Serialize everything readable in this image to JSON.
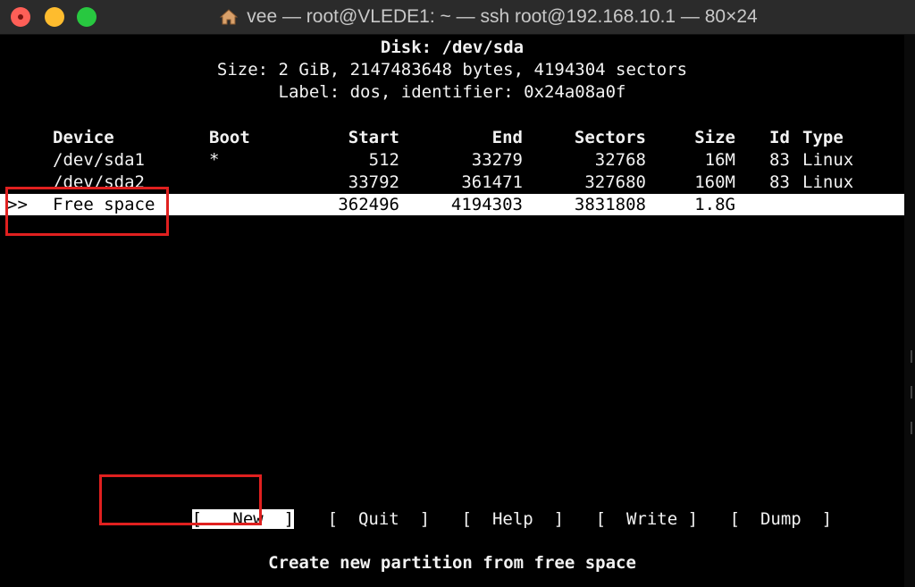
{
  "window": {
    "title": "vee — root@VLEDE1: ~ — ssh root@192.168.10.1 — 80×24",
    "icon": "home-icon"
  },
  "header": {
    "disk": "Disk: /dev/sda",
    "size": "Size: 2 GiB, 2147483648 bytes, 4194304 sectors",
    "label": "Label: dos, identifier: 0x24a08a0f"
  },
  "table": {
    "columns": [
      "Device",
      "Boot",
      "Start",
      "End",
      "Sectors",
      "Size",
      "Id",
      "Type"
    ],
    "rows": [
      {
        "marker": "",
        "device": "/dev/sda1",
        "boot": "*",
        "start": "512",
        "end": "33279",
        "sectors": "32768",
        "size": "16M",
        "id": "83",
        "type": "Linux"
      },
      {
        "marker": "",
        "device": "/dev/sda2",
        "boot": "",
        "start": "33792",
        "end": "361471",
        "sectors": "327680",
        "size": "160M",
        "id": "83",
        "type": "Linux"
      },
      {
        "marker": ">>",
        "device": "Free space",
        "boot": "",
        "start": "362496",
        "end": "4194303",
        "sectors": "3831808",
        "size": "1.8G",
        "id": "",
        "type": ""
      }
    ]
  },
  "menu": {
    "new": "[   New  ]",
    "quit": "[  Quit  ]",
    "help": "[  Help  ]",
    "write": "[  Write ]",
    "dump": "[  Dump  ]"
  },
  "status": "Create new partition from free space",
  "colors": {
    "annotation": "#e0201f",
    "selection_bg": "#ffffff",
    "terminal_bg": "#000000"
  }
}
